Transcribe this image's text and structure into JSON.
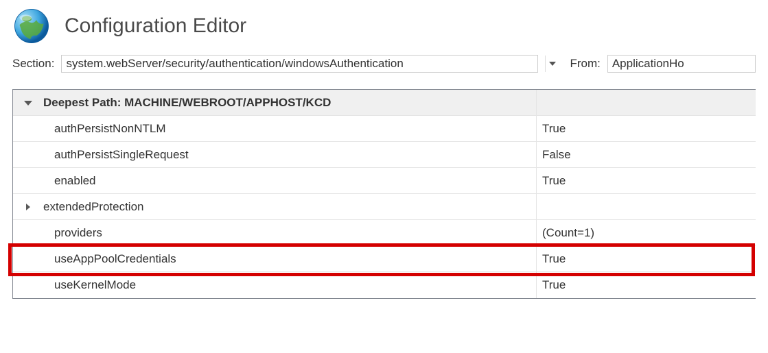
{
  "page": {
    "title": "Configuration Editor"
  },
  "toolbar": {
    "section_label": "Section:",
    "section_value": "system.webServer/security/authentication/windowsAuthentication",
    "from_label": "From:",
    "from_value": "ApplicationHo"
  },
  "grid": {
    "header_prefix": "Deepest Path: ",
    "header_path": "MACHINE/WEBROOT/APPHOST/KCD",
    "rows": [
      {
        "name": "authPersistNonNTLM",
        "value": "True",
        "expandable": false
      },
      {
        "name": "authPersistSingleRequest",
        "value": "False",
        "expandable": false
      },
      {
        "name": "enabled",
        "value": "True",
        "expandable": false
      },
      {
        "name": "extendedProtection",
        "value": "",
        "expandable": true
      },
      {
        "name": "providers",
        "value": "(Count=1)",
        "expandable": false
      },
      {
        "name": "useAppPoolCredentials",
        "value": "True",
        "expandable": false
      },
      {
        "name": "useKernelMode",
        "value": "True",
        "expandable": false
      }
    ]
  }
}
